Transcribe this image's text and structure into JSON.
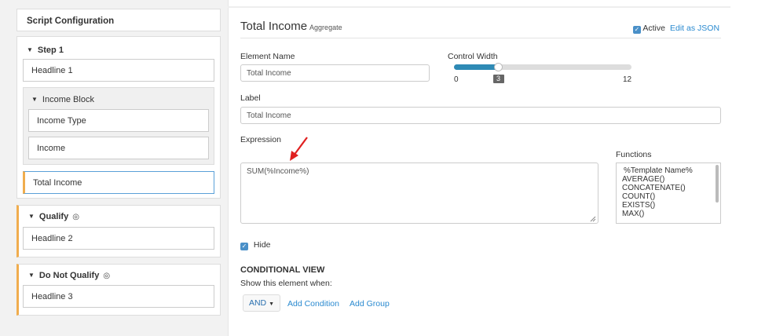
{
  "sidebar": {
    "header": "Script Configuration",
    "step1": {
      "title": "Step 1",
      "headline": "Headline 1",
      "income_block": {
        "title": "Income Block",
        "items": [
          "Income Type",
          "Income"
        ]
      },
      "total_income": "Total Income"
    },
    "qualify": {
      "title": "Qualify",
      "headline": "Headline 2"
    },
    "do_not_qualify": {
      "title": "Do Not Qualify",
      "headline": "Headline 3"
    }
  },
  "main": {
    "title": "Total Income",
    "subtitle": "Aggregate",
    "active_label": "Active",
    "edit_json_label": "Edit as JSON",
    "element_name": {
      "label": "Element Name",
      "value": "Total Income"
    },
    "control_width": {
      "label": "Control Width",
      "value": "3",
      "min_label": "0",
      "max_label": "12",
      "fraction": 0.25
    },
    "label_field": {
      "label": "Label",
      "value": "Total Income"
    },
    "expression": {
      "label": "Expression",
      "value": "SUM(%Income%)"
    },
    "functions": {
      "label": "Functions",
      "items": [
        "%Template Name%",
        "AVERAGE()",
        "CONCATENATE()",
        "COUNT()",
        "EXISTS()",
        "MAX()"
      ]
    },
    "hide_label": "Hide",
    "conditional_view": {
      "heading": "CONDITIONAL VIEW",
      "subtitle": "Show this element when:",
      "and_label": "AND",
      "add_condition": "Add Condition",
      "add_group": "Add Group"
    }
  },
  "colors": {
    "accent": "#2e8ab5",
    "link": "#2a8ad0",
    "orange": "#f0ad4e",
    "arrow": "#e02020"
  },
  "icons": [
    "triangle-down-icon",
    "eye-icon",
    "checkbox-checked-icon",
    "caret-down-icon",
    "red-arrow-icon",
    "resize-handle-icon"
  ]
}
